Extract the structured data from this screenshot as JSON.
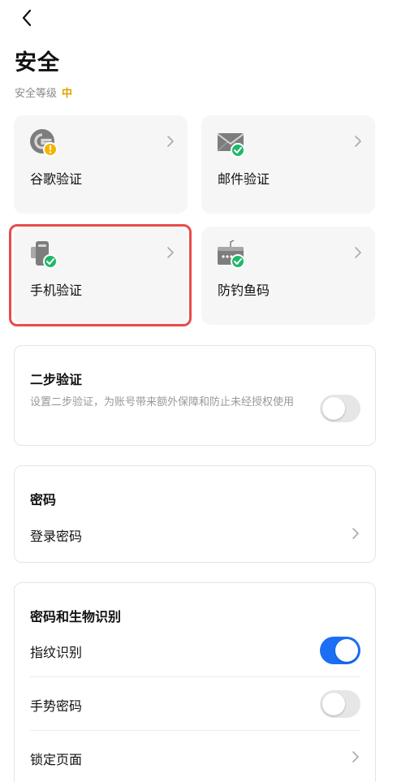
{
  "header": {
    "back_icon": "chevron-left-icon",
    "title": "安全",
    "level_label": "安全等级",
    "level_value": "中"
  },
  "tiles": [
    {
      "label": "谷歌验证",
      "icon": "google-authenticator-icon",
      "status": "warning"
    },
    {
      "label": "邮件验证",
      "icon": "email-icon",
      "status": "verified"
    },
    {
      "label": "手机验证",
      "icon": "phone-icon",
      "status": "verified",
      "highlighted": true
    },
    {
      "label": "防钓鱼码",
      "icon": "anti-phishing-icon",
      "status": "verified"
    }
  ],
  "two_step": {
    "title": "二步验证",
    "description": "设置二步验证，为账号带来额外保障和防止未经授权使用",
    "enabled": false
  },
  "password": {
    "title": "密码",
    "login_label": "登录密码"
  },
  "biometrics": {
    "title": "密码和生物识别",
    "fingerprint_label": "指纹识别",
    "fingerprint_enabled": true,
    "gesture_label": "手势密码",
    "gesture_enabled": false,
    "lock_label": "锁定页面"
  },
  "colors": {
    "accent": "#1a6ff5",
    "level": "#e6a100",
    "verified": "#1fb86a",
    "warning": "#f5b400",
    "highlight": "#e84c4c"
  }
}
